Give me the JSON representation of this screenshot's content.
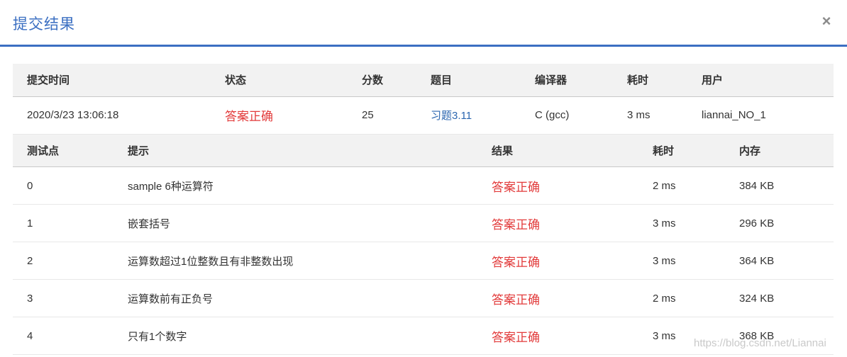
{
  "dialog": {
    "title": "提交结果",
    "close_label": "×"
  },
  "submission": {
    "headers": [
      "提交时间",
      "状态",
      "分数",
      "题目",
      "编译器",
      "耗时",
      "用户"
    ],
    "row": {
      "time": "2020/3/23 13:06:18",
      "status": "答案正确",
      "score": "25",
      "problem": "习题3.11",
      "compiler": "C (gcc)",
      "runtime": "3 ms",
      "user": "liannai_NO_1"
    }
  },
  "testcases": {
    "headers": [
      "测试点",
      "提示",
      "结果",
      "耗时",
      "内存"
    ],
    "rows": [
      {
        "id": "0",
        "hint": "sample 6种运算符",
        "result": "答案正确",
        "time": "2 ms",
        "memory": "384 KB"
      },
      {
        "id": "1",
        "hint": "嵌套括号",
        "result": "答案正确",
        "time": "3 ms",
        "memory": "296 KB"
      },
      {
        "id": "2",
        "hint": "运算数超过1位整数且有非整数出现",
        "result": "答案正确",
        "time": "3 ms",
        "memory": "364 KB"
      },
      {
        "id": "3",
        "hint": "运算数前有正负号",
        "result": "答案正确",
        "time": "2 ms",
        "memory": "324 KB"
      },
      {
        "id": "4",
        "hint": "只有1个数字",
        "result": "答案正确",
        "time": "3 ms",
        "memory": "368 KB"
      }
    ]
  },
  "watermark": "https://blog.csdn.net/Liannai",
  "colors": {
    "accent": "#3b6fc2",
    "accepted": "#e23b3b",
    "link": "#2b66b0"
  }
}
